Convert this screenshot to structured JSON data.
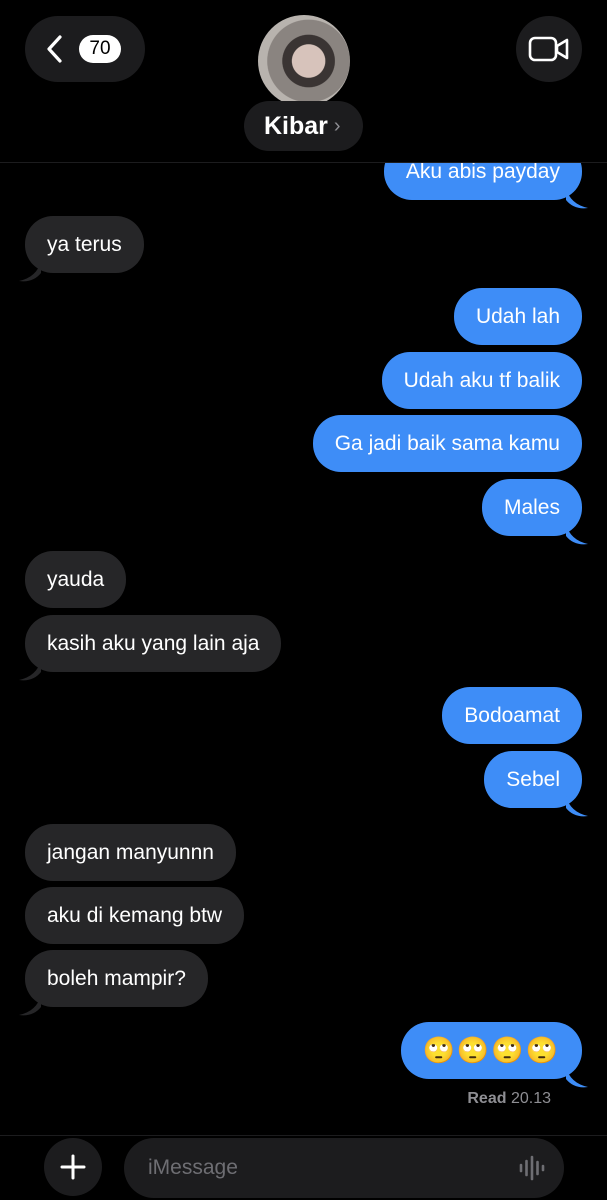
{
  "header": {
    "unread_count": "70",
    "contact_name": "Kibar",
    "chevron": "›"
  },
  "messages": [
    {
      "side": "out",
      "text": "Aku abis payday"
    },
    {
      "side": "in",
      "text": "ya terus"
    },
    {
      "side": "out",
      "text": "Udah lah"
    },
    {
      "side": "out",
      "text": "Udah aku tf balik"
    },
    {
      "side": "out",
      "text": "Ga jadi baik sama kamu"
    },
    {
      "side": "out",
      "text": "Males"
    },
    {
      "side": "in",
      "text": "yauda"
    },
    {
      "side": "in",
      "text": "kasih aku yang lain aja"
    },
    {
      "side": "out",
      "text": "Bodoamat"
    },
    {
      "side": "out",
      "text": "Sebel"
    },
    {
      "side": "in",
      "text": "jangan manyunnn"
    },
    {
      "side": "in",
      "text": "aku di kemang btw"
    },
    {
      "side": "in",
      "text": "boleh mampir?"
    },
    {
      "side": "out",
      "text": "🙄🙄🙄🙄"
    }
  ],
  "receipt": {
    "label": "Read",
    "time": "20.13"
  },
  "input": {
    "placeholder": "iMessage"
  },
  "icons": {
    "back": "chevron-left-icon",
    "video": "video-camera-icon",
    "plus": "plus-icon",
    "audio": "waveform-icon"
  },
  "colors": {
    "background": "#000000",
    "outgoing_bubble": "#3e8df7",
    "incoming_bubble": "#262628",
    "toolbar_button": "#1c1c1e",
    "muted_text": "#8e8e93"
  }
}
